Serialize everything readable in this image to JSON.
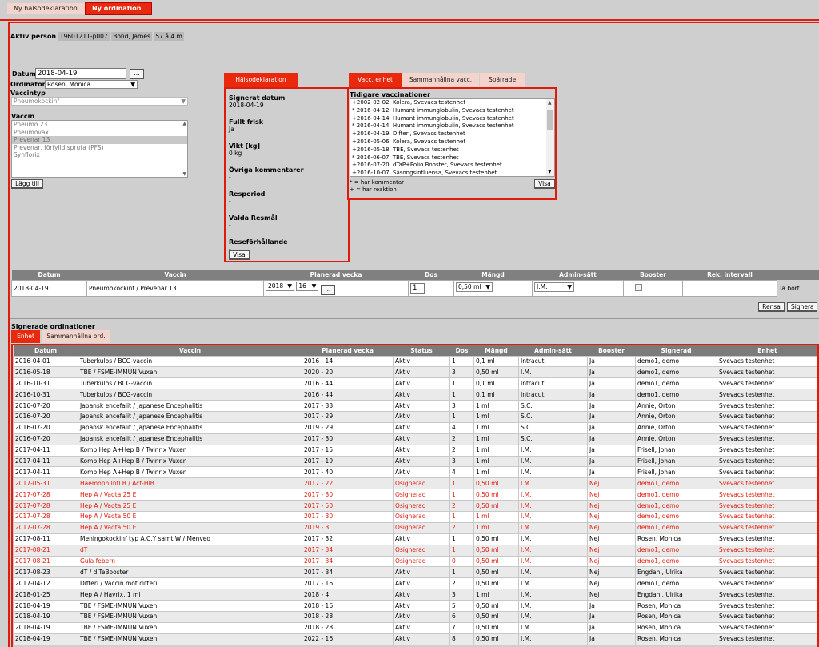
{
  "colors": {
    "accent": "#e8290e",
    "tab_inactive": "#f2d4cc",
    "header_gray": "#7b7b7b"
  },
  "top_tabs": [
    {
      "label": "Ny hälsodeklaration"
    },
    {
      "label": "Ny ordination"
    }
  ],
  "patient": {
    "label": "Aktiv person",
    "id": "19601211-p007",
    "name": "Bond, James",
    "age": "57 å 4 m"
  },
  "form": {
    "datum_label": "Datum",
    "datum_value": "2018-04-19",
    "date_btn": "...",
    "ordinator_label": "Ordinatör",
    "ordinator_value": "Rosen, Monica",
    "vaccintyp_label": "Vaccintyp",
    "vaccintyp_value": "Pneumokockinf",
    "vaccin_label": "Vaccin",
    "vaccin_options": [
      "Pneumo 23",
      "Pneumovax",
      "Prevenar 13",
      "Prevenar, förfylld spruta (PFS)",
      "Synflorix"
    ],
    "add_btn": "Lägg till"
  },
  "health": {
    "tab": "Hälsodeklaration",
    "fields": [
      {
        "k": "Signerat datum",
        "v": "2018-04-19"
      },
      {
        "k": "Fullt frisk",
        "v": "Ja"
      },
      {
        "k": "Vikt [kg]",
        "v": "0 kg"
      },
      {
        "k": "Övriga kommentarer",
        "v": "-"
      },
      {
        "k": "Resperiod",
        "v": "-"
      },
      {
        "k": "Valda Resmål",
        "v": "-"
      },
      {
        "k": "Reseförhållande",
        "v": "-"
      }
    ],
    "show_btn": "Visa"
  },
  "prev": {
    "tabs": [
      "Vacc. enhet",
      "Sammanhållna vacc.",
      "Spärrade"
    ],
    "title": "Tidigare vaccinationer",
    "items": [
      "+2002-02-02, Kolera, Svevacs testenhet",
      "* 2016-04-12, Humant immunglobulin, Svevacs testenhet",
      "+2016-04-14, Humant immunglobulin, Svevacs testenhet",
      "* 2016-04-14, Humant immunglobulin, Svevacs testenhet",
      "+2016-04-19, Difteri, Svevacs testenhet",
      "+2016-05-06, Kolera, Svevacs testenhet",
      "+2016-05-18, TBE, Svevacs testenhet",
      "* 2016-06-07, TBE, Svevacs testenhet",
      "+2016-07-20, dTaP+Polio Booster, Svevacs testenhet",
      "+2016-10-07, Säsongsinfluensa, Svevacs testenhet"
    ],
    "legend1": "* = har kommentar",
    "legend2": "+ = har reaktion",
    "show_btn": "Visa"
  },
  "order": {
    "headers": [
      "Datum",
      "Vaccin",
      "Planerad vecka",
      "Dos",
      "Mängd",
      "Admin-sätt",
      "Booster",
      "Rek. intervall",
      ""
    ],
    "row": {
      "datum": "2018-04-19",
      "vaccin": "Pneumokockinf / Prevenar 13",
      "year": "2018",
      "week": "16",
      "week_btn": "...",
      "dos": "1",
      "mangd": "0,50 ml",
      "admin": "I.M.",
      "remove": "Ta bort"
    },
    "clear_btn": "Rensa",
    "sign_btn": "Signera"
  },
  "signed": {
    "title": "Signerade ordinationer",
    "tabs": [
      "Enhet",
      "Sammanhållna ord."
    ],
    "headers": [
      "Datum",
      "Vaccin",
      "Planerad vecka",
      "Status",
      "Dos",
      "Mängd",
      "Admin-sätt",
      "Booster",
      "Signerad",
      "Enhet"
    ],
    "rows": [
      {
        "d": "2016-04-01",
        "v": "Tuberkulos / BCG-vaccin",
        "p": "2016 - 14",
        "s": "Aktiv",
        "dos": "1",
        "m": "0,1 ml",
        "a": "Intracut",
        "b": "Ja",
        "sig": "demo1, demo",
        "e": "Svevacs testenhet",
        "red": false
      },
      {
        "d": "2016-05-18",
        "v": "TBE / FSME-IMMUN Vuxen",
        "p": "2020 - 20",
        "s": "Aktiv",
        "dos": "3",
        "m": "0,50 ml",
        "a": "I.M.",
        "b": "Ja",
        "sig": "demo1, demo",
        "e": "Svevacs testenhet",
        "red": false
      },
      {
        "d": "2016-10-31",
        "v": "Tuberkulos / BCG-vaccin",
        "p": "2016 - 44",
        "s": "Aktiv",
        "dos": "1",
        "m": "0,1 ml",
        "a": "Intracut",
        "b": "Ja",
        "sig": "demo1, demo",
        "e": "Svevacs testenhet",
        "red": false
      },
      {
        "d": "2016-10-31",
        "v": "Tuberkulos / BCG-vaccin",
        "p": "2016 - 44",
        "s": "Aktiv",
        "dos": "1",
        "m": "0,1 ml",
        "a": "Intracut",
        "b": "Ja",
        "sig": "demo1, demo",
        "e": "Svevacs testenhet",
        "red": false
      },
      {
        "d": "2016-07-20",
        "v": "Japansk encefalit / Japanese Encephalitis",
        "p": "2017 - 33",
        "s": "Aktiv",
        "dos": "3",
        "m": "1 ml",
        "a": "S.C.",
        "b": "Ja",
        "sig": "Annie, Orton",
        "e": "Svevacs testenhet",
        "red": false
      },
      {
        "d": "2016-07-20",
        "v": "Japansk encefalit / Japanese Encephalitis",
        "p": "2017 - 29",
        "s": "Aktiv",
        "dos": "1",
        "m": "1 ml",
        "a": "S.C.",
        "b": "Ja",
        "sig": "Annie, Orton",
        "e": "Svevacs testenhet",
        "red": false
      },
      {
        "d": "2016-07-20",
        "v": "Japansk encefalit / Japanese Encephalitis",
        "p": "2019 - 29",
        "s": "Aktiv",
        "dos": "4",
        "m": "1 ml",
        "a": "S.C.",
        "b": "Ja",
        "sig": "Annie, Orton",
        "e": "Svevacs testenhet",
        "red": false
      },
      {
        "d": "2016-07-20",
        "v": "Japansk encefalit / Japanese Encephalitis",
        "p": "2017 - 30",
        "s": "Aktiv",
        "dos": "2",
        "m": "1 ml",
        "a": "S.C.",
        "b": "Ja",
        "sig": "Annie, Orton",
        "e": "Svevacs testenhet",
        "red": false
      },
      {
        "d": "2017-04-11",
        "v": "Komb Hep A+Hep B / Twinrix Vuxen",
        "p": "2017 - 15",
        "s": "Aktiv",
        "dos": "2",
        "m": "1 ml",
        "a": "I.M.",
        "b": "Ja",
        "sig": "Frisell, Johan",
        "e": "Svevacs testenhet",
        "red": false
      },
      {
        "d": "2017-04-11",
        "v": "Komb Hep A+Hep B / Twinrix Vuxen",
        "p": "2017 - 19",
        "s": "Aktiv",
        "dos": "3",
        "m": "1 ml",
        "a": "I.M.",
        "b": "Ja",
        "sig": "Frisell, Johan",
        "e": "Svevacs testenhet",
        "red": false
      },
      {
        "d": "2017-04-11",
        "v": "Komb Hep A+Hep B / Twinrix Vuxen",
        "p": "2017 - 40",
        "s": "Aktiv",
        "dos": "4",
        "m": "1 ml",
        "a": "I.M.",
        "b": "Ja",
        "sig": "Frisell, Johan",
        "e": "Svevacs testenhet",
        "red": false
      },
      {
        "d": "2017-05-31",
        "v": "Haemoph Infl B / Act-HIB",
        "p": "2017 - 22",
        "s": "Osignerad",
        "dos": "1",
        "m": "0,50 ml",
        "a": "I.M.",
        "b": "Nej",
        "sig": "demo1, demo",
        "e": "Svevacs testenhet",
        "red": true
      },
      {
        "d": "2017-07-28",
        "v": "Hep A / Vaqta 25 E",
        "p": "2017 - 30",
        "s": "Osignerad",
        "dos": "1",
        "m": "0,50 ml",
        "a": "I.M.",
        "b": "Nej",
        "sig": "demo1, demo",
        "e": "Svevacs testenhet",
        "red": true
      },
      {
        "d": "2017-07-28",
        "v": "Hep A / Vaqta 25 E",
        "p": "2017 - 50",
        "s": "Osignerad",
        "dos": "2",
        "m": "0,50 ml",
        "a": "I.M.",
        "b": "Nej",
        "sig": "demo1, demo",
        "e": "Svevacs testenhet",
        "red": true
      },
      {
        "d": "2017-07-28",
        "v": "Hep A / Vaqta 50 E",
        "p": "2017 - 30",
        "s": "Osignerad",
        "dos": "1",
        "m": "1 ml",
        "a": "I.M.",
        "b": "Nej",
        "sig": "demo1, demo",
        "e": "Svevacs testenhet",
        "red": true
      },
      {
        "d": "2017-07-28",
        "v": "Hep A / Vaqta 50 E",
        "p": "2019 - 3",
        "s": "Osignerad",
        "dos": "2",
        "m": "1 ml",
        "a": "I.M.",
        "b": "Nej",
        "sig": "demo1, demo",
        "e": "Svevacs testenhet",
        "red": true
      },
      {
        "d": "2017-08-11",
        "v": "Meningokockinf typ A,C,Y samt W / Menveo",
        "p": "2017 - 32",
        "s": "Aktiv",
        "dos": "1",
        "m": "0,50 ml",
        "a": "I.M.",
        "b": "Nej",
        "sig": "Rosen, Monica",
        "e": "Svevacs testenhet",
        "red": false
      },
      {
        "d": "2017-08-21",
        "v": "dT",
        "p": "2017 - 34",
        "s": "Osignerad",
        "dos": "1",
        "m": "0,50 ml",
        "a": "I.M.",
        "b": "Nej",
        "sig": "demo1, demo",
        "e": "Svevacs testenhet",
        "red": true
      },
      {
        "d": "2017-08-21",
        "v": "Gula febern",
        "p": "2017 - 34",
        "s": "Osignerad",
        "dos": "0",
        "m": "0,50 ml",
        "a": "I.M.",
        "b": "Nej",
        "sig": "demo1, demo",
        "e": "Svevacs testenhet",
        "red": true
      },
      {
        "d": "2017-08-23",
        "v": "dT / diTeBooster",
        "p": "2017 - 34",
        "s": "Aktiv",
        "dos": "1",
        "m": "0,50 ml",
        "a": "I.M.",
        "b": "Nej",
        "sig": "Engdahl, Ulrika",
        "e": "Svevacs testenhet",
        "red": false
      },
      {
        "d": "2017-04-12",
        "v": "Difteri / Vaccin mot difteri",
        "p": "2017 - 16",
        "s": "Aktiv",
        "dos": "2",
        "m": "0,50 ml",
        "a": "I.M.",
        "b": "Nej",
        "sig": "demo1, demo",
        "e": "Svevacs testenhet",
        "red": false
      },
      {
        "d": "2018-01-25",
        "v": "Hep A / Havrix, 1 ml",
        "p": "2018 - 4",
        "s": "Aktiv",
        "dos": "3",
        "m": "1 ml",
        "a": "I.M.",
        "b": "Nej",
        "sig": "Engdahl, Ulrika",
        "e": "Svevacs testenhet",
        "red": false
      },
      {
        "d": "2018-04-19",
        "v": "TBE / FSME-IMMUN Vuxen",
        "p": "2018 - 16",
        "s": "Aktiv",
        "dos": "5",
        "m": "0,50 ml",
        "a": "I.M.",
        "b": "Ja",
        "sig": "Rosen, Monica",
        "e": "Svevacs testenhet",
        "red": false
      },
      {
        "d": "2018-04-19",
        "v": "TBE / FSME-IMMUN Vuxen",
        "p": "2018 - 28",
        "s": "Aktiv",
        "dos": "6",
        "m": "0,50 ml",
        "a": "I.M.",
        "b": "Ja",
        "sig": "Rosen, Monica",
        "e": "Svevacs testenhet",
        "red": false
      },
      {
        "d": "2018-04-19",
        "v": "TBE / FSME-IMMUN Vuxen",
        "p": "2018 - 28",
        "s": "Aktiv",
        "dos": "7",
        "m": "0,50 ml",
        "a": "I.M.",
        "b": "Ja",
        "sig": "Rosen, Monica",
        "e": "Svevacs testenhet",
        "red": false
      },
      {
        "d": "2018-04-19",
        "v": "TBE / FSME-IMMUN Vuxen",
        "p": "2022 - 16",
        "s": "Aktiv",
        "dos": "8",
        "m": "0,50 ml",
        "a": "I.M.",
        "b": "Ja",
        "sig": "Rosen, Monica",
        "e": "Svevacs testenhet",
        "red": false
      }
    ]
  }
}
